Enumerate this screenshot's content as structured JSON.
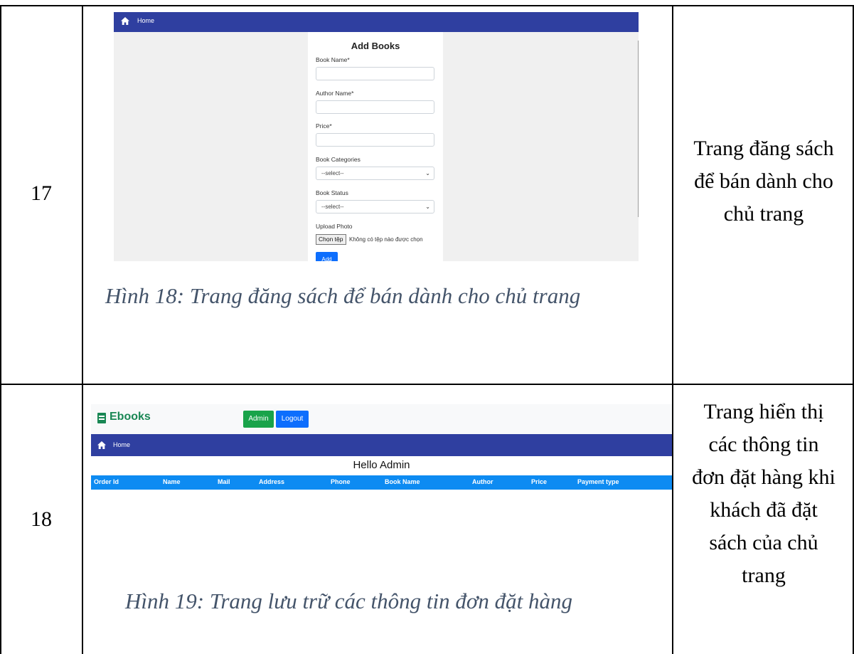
{
  "rows": [
    {
      "number": "17",
      "screenshot": {
        "nav_home": "Home",
        "form_title": "Add Books",
        "fields": {
          "book_name_label": "Book Name*",
          "author_name_label": "Author Name*",
          "price_label": "Price*",
          "categories_label": "Book Categories",
          "categories_selected": "--select--",
          "status_label": "Book Status",
          "status_selected": "--select--",
          "upload_label": "Upload Photo",
          "file_button": "Chọn tệp",
          "file_status": "Không có tệp nào được chọn",
          "add_button": "Add"
        }
      },
      "caption": "Hình 18: Trang đăng sách để bán dành cho chủ trang",
      "description_lines": [
        "Trang đăng sách",
        "để bán dành cho",
        "chủ trang"
      ]
    },
    {
      "number": "18",
      "screenshot": {
        "brand": "Ebooks",
        "admin_button": "Admin",
        "logout_button": "Logout",
        "nav_home": "Home",
        "greeting": "Hello Admin",
        "table_headers": [
          "Order Id",
          "Name",
          "Mail",
          "Address",
          "Phone",
          "Book Name",
          "Author",
          "Price",
          "Payment type"
        ]
      },
      "caption": "Hình 19: Trang lưu trữ các thông tin đơn đặt hàng",
      "description_lines": [
        "Trang hiển thị",
        "các thông tin",
        "đơn đặt hàng khi",
        "khách đã đặt",
        "sách của chủ",
        "trang"
      ]
    }
  ],
  "colors": {
    "navbar": "#2f3fa0",
    "table_header": "#0d8bf2",
    "brand_green": "#198754",
    "primary_blue": "#0d6efd",
    "caption": "#44546a"
  },
  "icons": [
    "home-icon",
    "book-icon",
    "chevron-down-icon"
  ]
}
